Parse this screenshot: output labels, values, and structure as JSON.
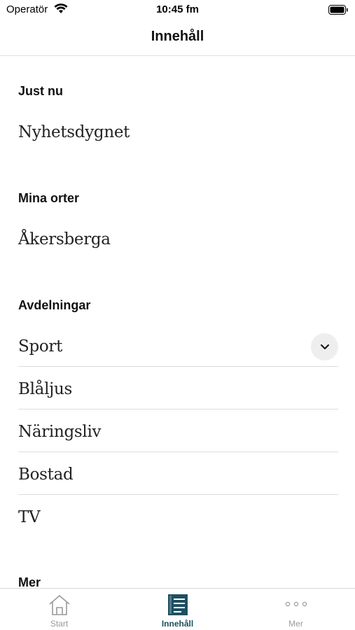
{
  "status_bar": {
    "carrier": "Operatör",
    "time": "10:45 fm"
  },
  "nav": {
    "title": "Innehåll"
  },
  "sections": {
    "just_nu": {
      "heading": "Just nu",
      "items": [
        "Nyhetsdygnet"
      ]
    },
    "mina_orter": {
      "heading": "Mina orter",
      "items": [
        "Åkersberga"
      ]
    },
    "avdelningar": {
      "heading": "Avdelningar",
      "items": [
        "Sport",
        "Blåljus",
        "Näringsliv",
        "Bostad",
        "TV"
      ]
    },
    "mer": {
      "heading": "Mer"
    }
  },
  "tab_bar": {
    "tabs": [
      {
        "label": "Start",
        "icon": "home-icon",
        "active": false
      },
      {
        "label": "Innehåll",
        "icon": "newspaper-icon",
        "active": true
      },
      {
        "label": "Mer",
        "icon": "more-dots-icon",
        "active": false
      }
    ]
  },
  "colors": {
    "accent": "#1e4f62",
    "inactive": "#9a9a9a",
    "divider": "#dcdcdc"
  }
}
